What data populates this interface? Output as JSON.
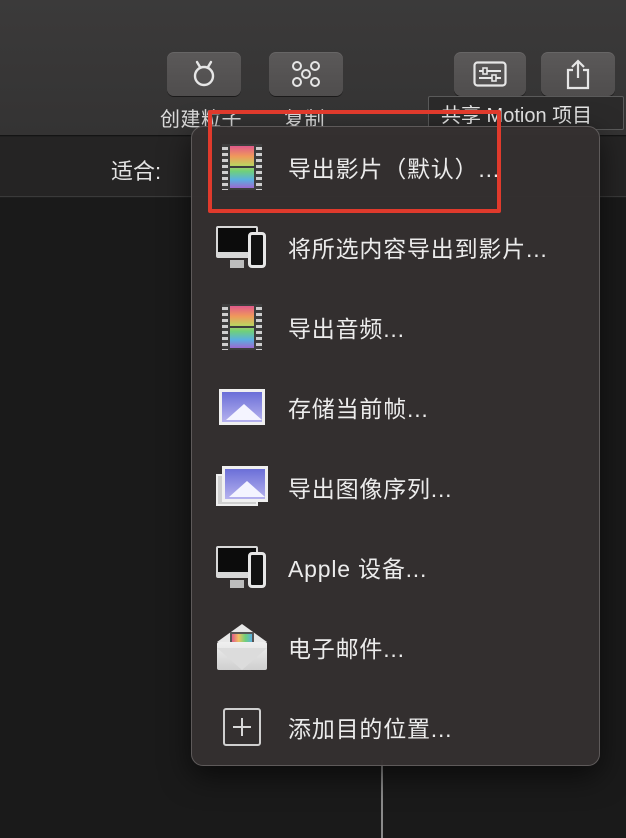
{
  "toolbar": {
    "particle_label": "创建粒子",
    "replicate_label": "复制",
    "particle_icon": "particle-emitter-icon",
    "replicate_icon": "replicator-icon",
    "settings_icon": "sliders-icon",
    "share_icon": "share-icon",
    "tooltip": "共享 Motion 项目"
  },
  "viewer": {
    "fit_label": "适合:"
  },
  "menu": {
    "items": [
      {
        "label": "导出影片（默认）...",
        "icon": "film-icon"
      },
      {
        "label": "将所选内容导出到影片...",
        "icon": "devices-icon"
      },
      {
        "label": "导出音频...",
        "icon": "film-icon"
      },
      {
        "label": "存储当前帧...",
        "icon": "photo-icon"
      },
      {
        "label": "导出图像序列...",
        "icon": "photo-stack-icon"
      },
      {
        "label": "Apple 设备...",
        "icon": "devices-icon"
      },
      {
        "label": "电子邮件...",
        "icon": "mail-icon"
      },
      {
        "label": "添加目的位置...",
        "icon": "add-icon"
      }
    ]
  },
  "colors": {
    "highlight": "#e03a2c",
    "menu_bg": "#343030",
    "toolbar_bg": "#3b3a3a"
  }
}
